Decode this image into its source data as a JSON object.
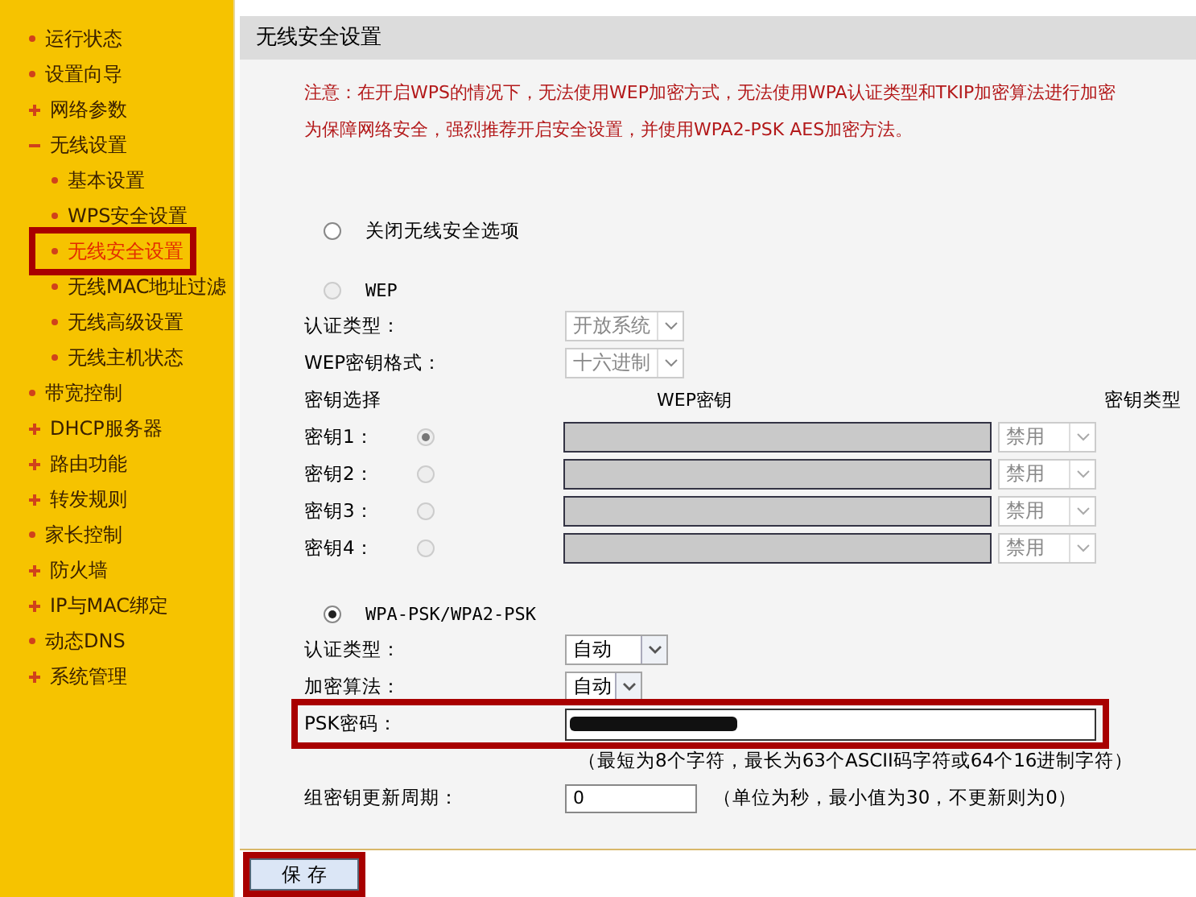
{
  "sidebar": {
    "items": [
      {
        "kind": "link",
        "label": "运行状态",
        "selected": false
      },
      {
        "kind": "link",
        "label": "设置向导",
        "selected": false
      },
      {
        "kind": "group",
        "label": "网络参数",
        "expanded": false,
        "selected": false
      },
      {
        "kind": "group",
        "label": "无线设置",
        "expanded": true,
        "selected": false,
        "children": [
          {
            "label": "基本设置",
            "selected": false,
            "highlighted": false
          },
          {
            "label": "WPS安全设置",
            "selected": false,
            "highlighted": false
          },
          {
            "label": "无线安全设置",
            "selected": true,
            "highlighted": true
          },
          {
            "label": "无线MAC地址过滤",
            "selected": false,
            "highlighted": false
          },
          {
            "label": "无线高级设置",
            "selected": false,
            "highlighted": false
          },
          {
            "label": "无线主机状态",
            "selected": false,
            "highlighted": false
          }
        ]
      },
      {
        "kind": "link",
        "label": "带宽控制",
        "selected": false
      },
      {
        "kind": "group",
        "label": "DHCP服务器",
        "expanded": false,
        "selected": false
      },
      {
        "kind": "group",
        "label": "路由功能",
        "expanded": false,
        "selected": false
      },
      {
        "kind": "group",
        "label": "转发规则",
        "expanded": false,
        "selected": false
      },
      {
        "kind": "link",
        "label": "家长控制",
        "selected": false
      },
      {
        "kind": "group",
        "label": "防火墙",
        "expanded": false,
        "selected": false
      },
      {
        "kind": "group",
        "label": "IP与MAC绑定",
        "expanded": false,
        "selected": false
      },
      {
        "kind": "link",
        "label": "动态DNS",
        "selected": false
      },
      {
        "kind": "group",
        "label": "系统管理",
        "expanded": false,
        "selected": false
      }
    ]
  },
  "panel": {
    "title": "无线安全设置",
    "notice": [
      "注意：在开启WPS的情况下，无法使用WEP加密方式，无法使用WPA认证类型和TKIP加密算法进行加密",
      "为保障网络安全，强烈推荐开启安全设置，并使用WPA2-PSK AES加密方法。"
    ],
    "off_option": {
      "label": "关闭无线安全选项",
      "selected": false
    },
    "wep": {
      "label": "WEP",
      "selected": false,
      "disabled": true,
      "fields": [
        {
          "label": "认证类型：",
          "value": "开放系统"
        },
        {
          "label": "WEP密钥格式：",
          "value": "十六进制"
        }
      ],
      "key_headers": [
        "密钥选择",
        "WEP密钥",
        "密钥类型"
      ],
      "keys": [
        {
          "label": "密钥1：",
          "selected": true,
          "type": "禁用"
        },
        {
          "label": "密钥2：",
          "selected": false,
          "type": "禁用"
        },
        {
          "label": "密钥3：",
          "selected": false,
          "type": "禁用"
        },
        {
          "label": "密钥4：",
          "selected": false,
          "type": "禁用"
        }
      ]
    },
    "wpa": {
      "label": "WPA-PSK/WPA2-PSK",
      "selected": true,
      "fields": [
        {
          "kind": "select",
          "label": "认证类型：",
          "value": "自动"
        },
        {
          "kind": "select",
          "label": "加密算法：",
          "value": "自动"
        },
        {
          "kind": "password",
          "label": "PSK密码：",
          "redacted": true,
          "highlighted": true,
          "hint": "（最短为8个字符，最长为63个ASCII码字符或64个16进制字符）"
        },
        {
          "kind": "text",
          "label": "组密钥更新周期：",
          "value": "0",
          "hint": "（单位为秒，最小值为30，不更新则为0）"
        }
      ]
    },
    "save_button": {
      "label": "保 存",
      "highlighted": true
    }
  }
}
